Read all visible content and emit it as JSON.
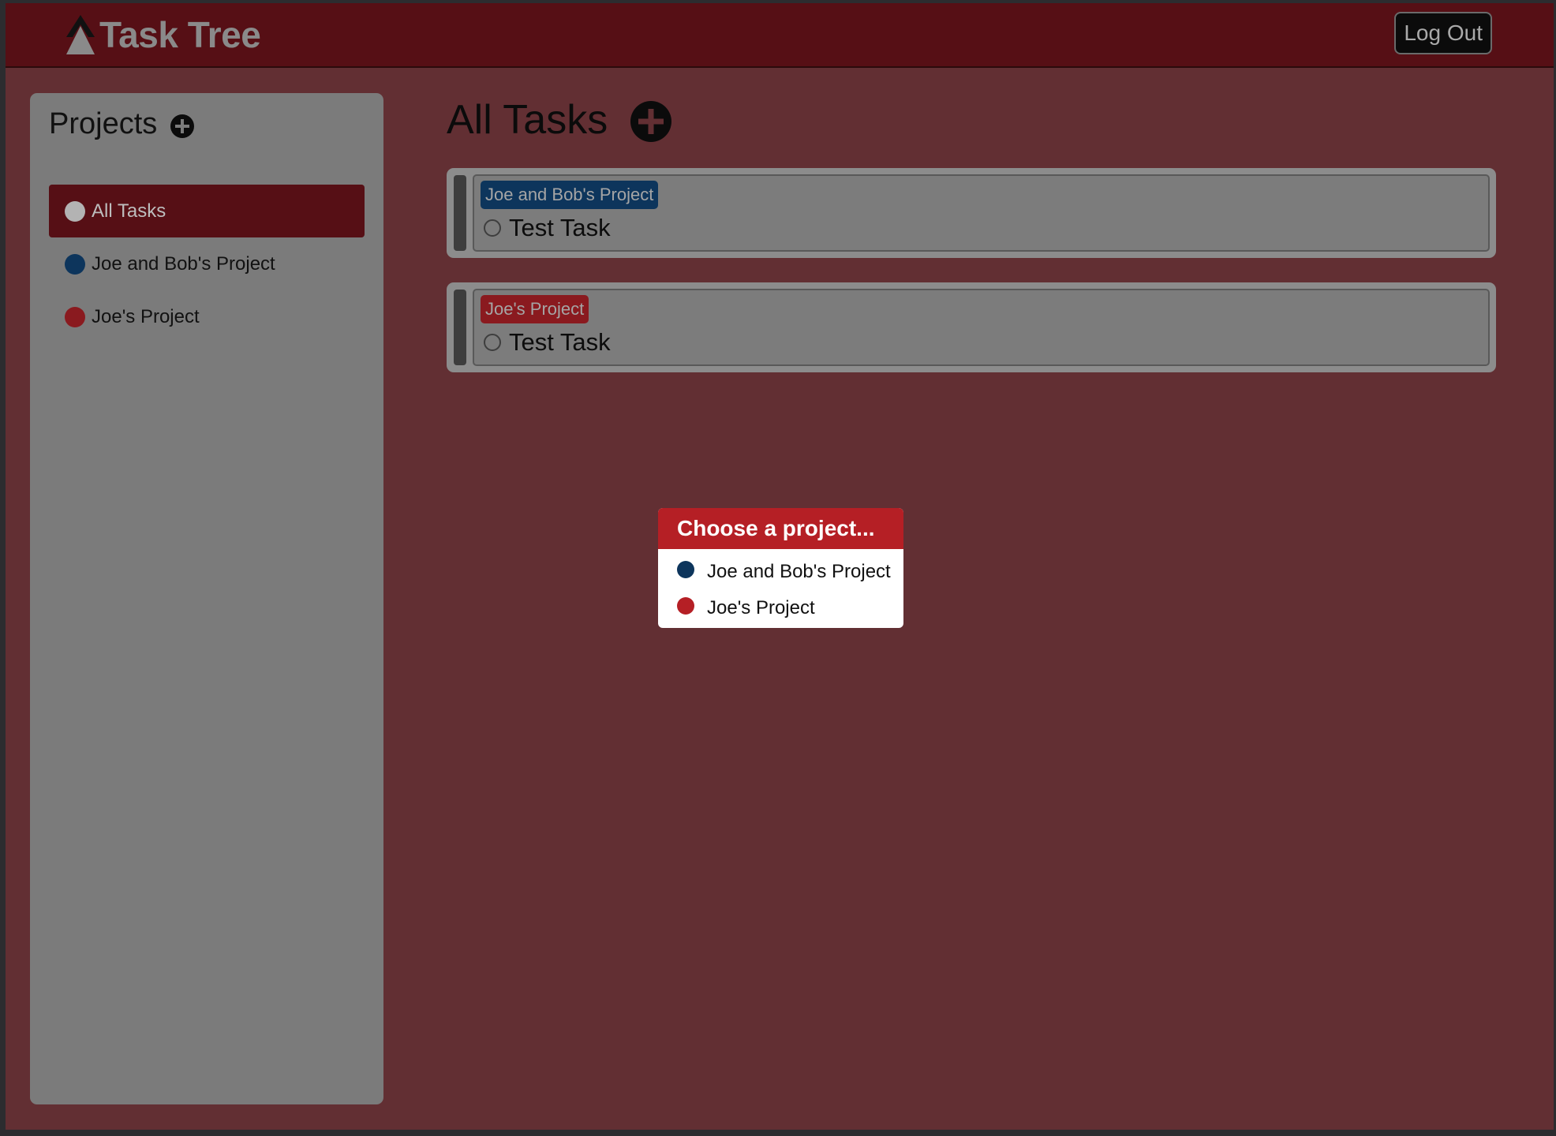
{
  "app": {
    "name": "Task Tree",
    "logout_label": "Log Out"
  },
  "colors": {
    "header": "#560f15",
    "background": "#622f33",
    "sidebar": "#7b7b7b",
    "active_nav": "#560f15",
    "joe_and_bob_project": "#0d355c",
    "joes_project": "#8a1a1f",
    "all_tasks_dot": "#b3b3b3",
    "popup_header": "#b51f25",
    "popup_joe_and_bob_dot": "#0d355c",
    "popup_joes_dot": "#b51f25"
  },
  "sidebar": {
    "title": "Projects",
    "add_icon": "plus-circle-icon",
    "items": [
      {
        "label": "All Tasks",
        "color": "#b3b3b3",
        "active": true
      },
      {
        "label": "Joe and Bob's Project",
        "color": "#0d355c",
        "active": false
      },
      {
        "label": "Joe's Project",
        "color": "#8a1a1f",
        "active": false
      }
    ]
  },
  "main": {
    "title": "All Tasks",
    "add_icon": "plus-circle-icon",
    "tasks": [
      {
        "project": "Joe and Bob's Project",
        "project_color": "#0d355c",
        "name": "Test Task",
        "done": false
      },
      {
        "project": "Joe's Project",
        "project_color": "#8a1a1f",
        "name": "Test Task",
        "done": false
      }
    ]
  },
  "popup": {
    "title": "Choose a project...",
    "options": [
      {
        "label": "Joe and Bob's Project",
        "color": "#0d355c"
      },
      {
        "label": "Joe's Project",
        "color": "#b51f25"
      }
    ]
  }
}
